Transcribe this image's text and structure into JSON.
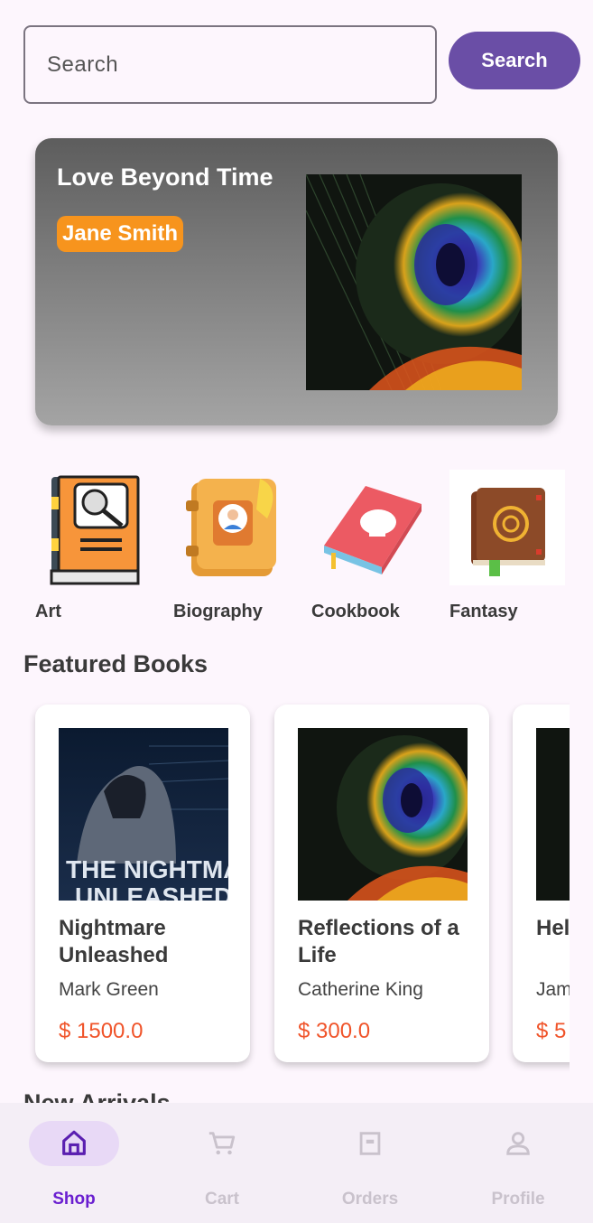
{
  "search": {
    "placeholder": "Search",
    "button_label": "Search"
  },
  "hero": {
    "title": "Love Beyond Time",
    "author": "Jane Smith",
    "badge_color": "#f7941d"
  },
  "categories": [
    {
      "label": "Art",
      "icon": "art-book-icon"
    },
    {
      "label": "Biography",
      "icon": "biography-book-icon"
    },
    {
      "label": "Cookbook",
      "icon": "cookbook-icon"
    },
    {
      "label": "Fantasy",
      "icon": "fantasy-book-icon"
    }
  ],
  "featured": {
    "title": "Featured Books",
    "books": [
      {
        "title": "Nightmare Unleashed",
        "author": "Mark Green",
        "price": "$ 1500.0",
        "cover_text_top": "THE NIGHTMARE",
        "cover_text_bottom": "UNLEASHED"
      },
      {
        "title": "Reflections of a Life",
        "author": "Catherine King",
        "price": "$ 300.0"
      },
      {
        "title": "Hel",
        "author": "Jam",
        "price": "$ 5"
      }
    ]
  },
  "new_arrivals_title": "New Arrivals",
  "nav": {
    "items": [
      {
        "label": "Shop",
        "icon": "home-icon",
        "active": true
      },
      {
        "label": "Cart",
        "icon": "cart-icon",
        "active": false
      },
      {
        "label": "Orders",
        "icon": "orders-icon",
        "active": false
      },
      {
        "label": "Profile",
        "icon": "profile-icon",
        "active": false
      }
    ]
  },
  "colors": {
    "primary": "#6a4ea6",
    "price": "#f0542a",
    "active_nav": "#6a1fd0"
  }
}
